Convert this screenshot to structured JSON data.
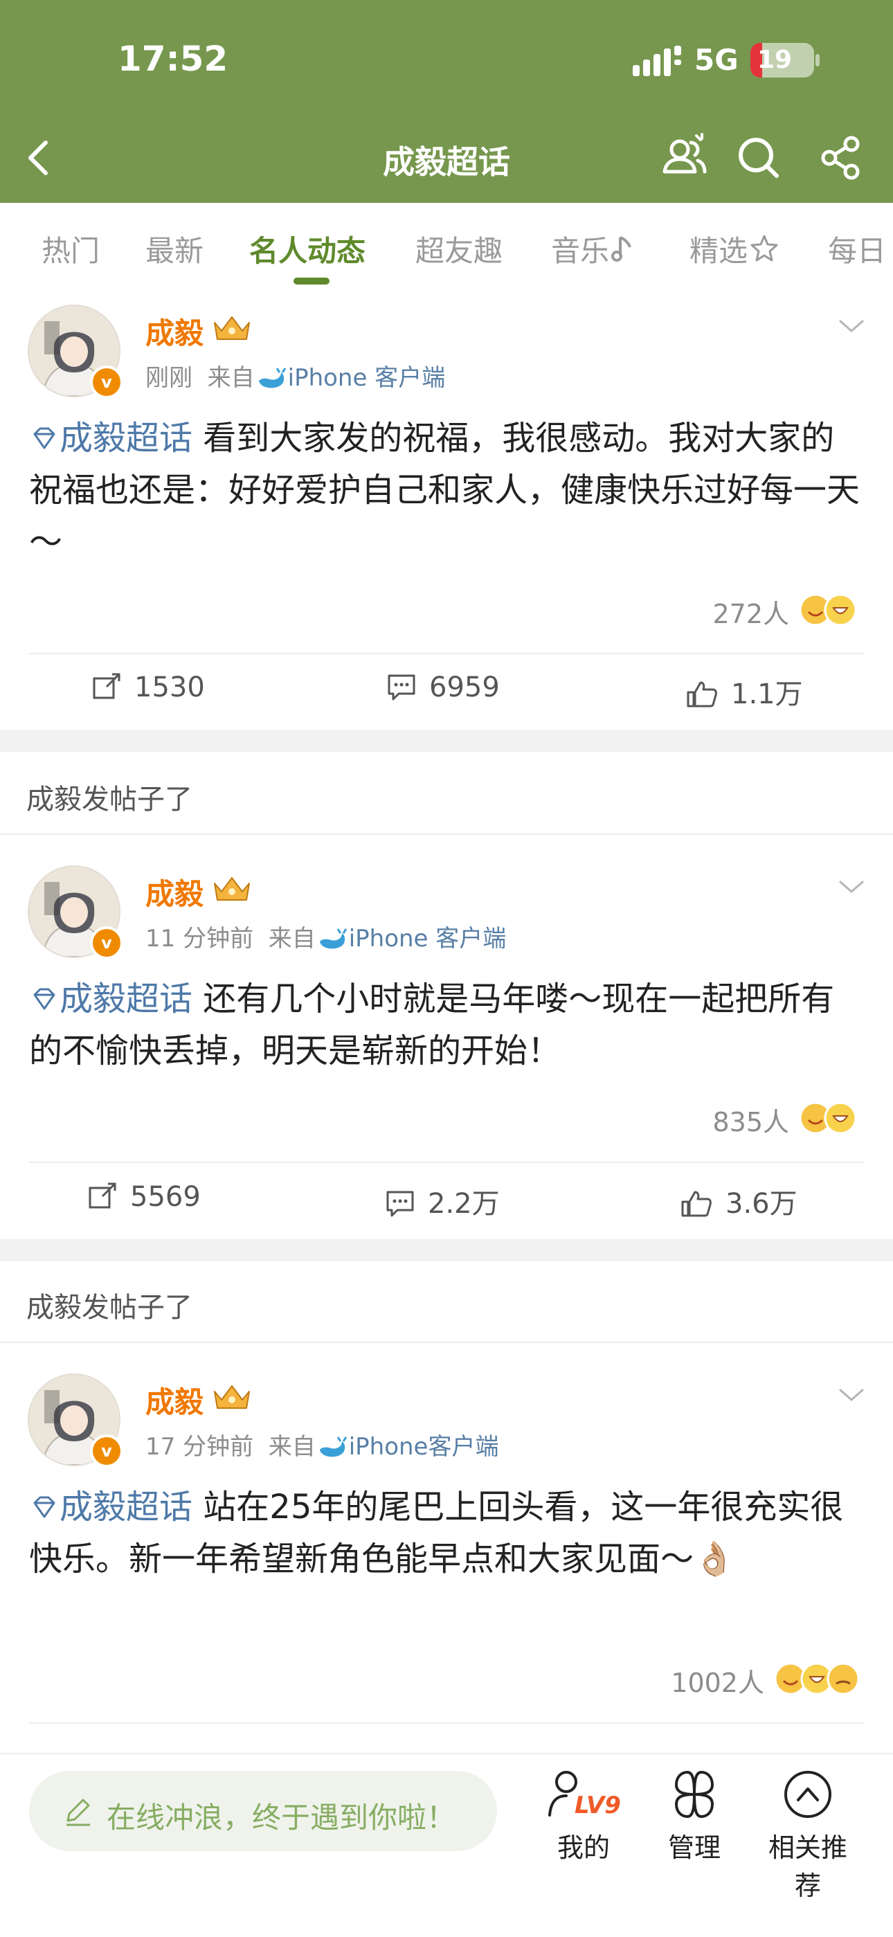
{
  "status_bar": {
    "time": "17:52",
    "network": "5G",
    "battery": "19",
    "battery_level": 0.19,
    "battery_color": "#e4343a"
  },
  "nav": {
    "title": "成毅超话",
    "icons": [
      "back-arrow-icon",
      "people-icon",
      "search-icon",
      "share-icon"
    ]
  },
  "tabs": [
    "热门",
    "最新",
    "名人动态",
    "超友趣",
    "音乐",
    "精选",
    "每日"
  ],
  "active_tab": "名人动态",
  "colors": {
    "header": "#76974d",
    "accent": "#5f8a2c",
    "author": "#f07800",
    "topic": "#4e79a8"
  },
  "posts": [
    {
      "author": "成毅",
      "time": "刚刚",
      "from": "来自",
      "client": "iPhone 客户端",
      "topic": "成毅超话",
      "text": "看到大家发的祝福，我很感动。我对大家的祝福也还是：好好爱护自己和家人，健康快乐过好每一天～",
      "reactions": "272人",
      "reposts": "1530",
      "comments": "6959",
      "likes": "1.1万"
    },
    {
      "section": "成毅发帖子了",
      "author": "成毅",
      "time": "11 分钟前",
      "from": "来自",
      "client": "iPhone 客户端",
      "topic": "成毅超话",
      "text": "还有几个小时就是马年喽～现在一起把所有的不愉快丢掉，明天是崭新的开始！",
      "reactions": "835人",
      "reposts": "5569",
      "comments": "2.2万",
      "likes": "3.6万"
    },
    {
      "section": "成毅发帖子了",
      "author": "成毅",
      "time": "17 分钟前",
      "from": "来自",
      "client": "iPhone客户端",
      "topic": "成毅超话",
      "text": "站在25年的尾巴上回头看，这一年很充实很快乐。新一年希望新角色能早点和大家见面～👌🏼",
      "reactions": "1002人"
    }
  ],
  "bottom": {
    "compose_placeholder": "在线冲浪，终于遇到你啦！",
    "level_badge": "LV9",
    "items": [
      "我的",
      "管理",
      "相关推荐"
    ]
  }
}
